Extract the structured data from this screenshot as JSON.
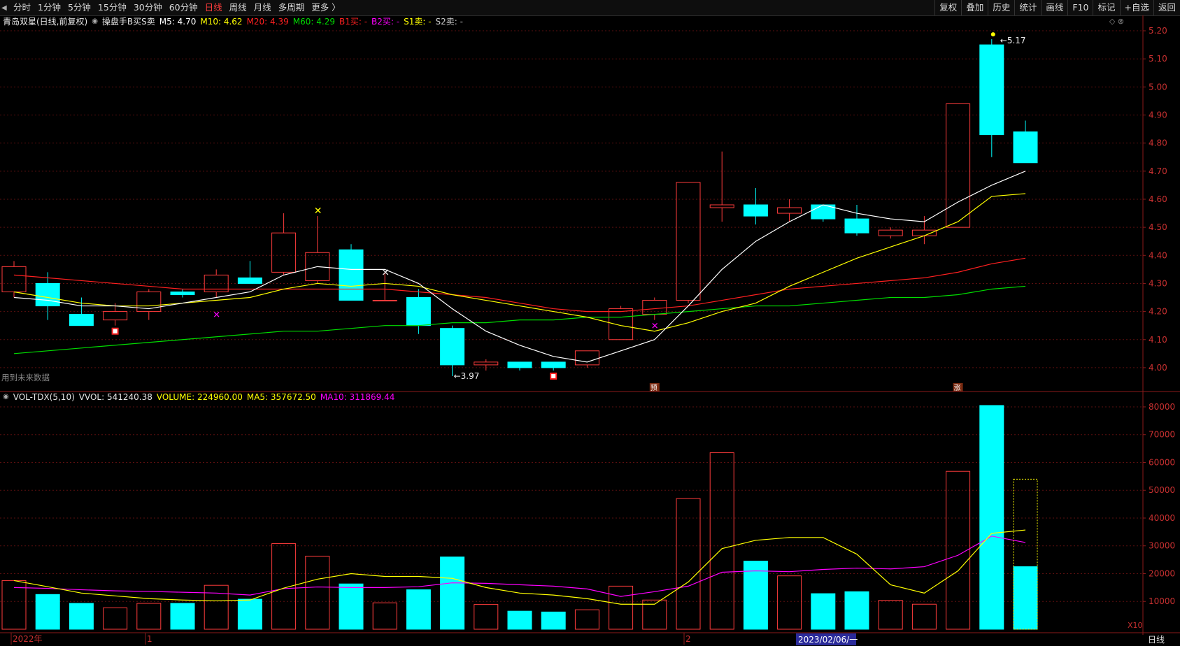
{
  "toolbar": {
    "left_items": [
      "分时",
      "1分钟",
      "5分钟",
      "15分钟",
      "30分钟",
      "60分钟",
      "日线",
      "周线",
      "月线",
      "多周期",
      "更多 〉"
    ],
    "active": "日线",
    "right_items": [
      "复权",
      "叠加",
      "历史",
      "统计",
      "画线",
      "F10",
      "标记",
      "+自选",
      "返回"
    ]
  },
  "price_legend": {
    "stock": "青岛双星(日线,前复权)",
    "indicator": "操盘手B买S卖",
    "m5": "M5: 4.70",
    "m10": "M10: 4.62",
    "m20": "M20: 4.39",
    "m60": "M60: 4.29",
    "b1": "B1买: -",
    "b2": "B2买: -",
    "s1": "S1卖: -",
    "s2": "S2卖: -"
  },
  "volume_legend": {
    "name": "VOL-TDX(5,10)",
    "vvol": "VVOL: 541240.38",
    "volume": "VOLUME: 224960.00",
    "ma5": "MA5: 357672.50",
    "ma10": "MA10: 311869.44"
  },
  "annotations": {
    "future_data": "用到未来数据",
    "high_label": "5.17",
    "low_label": "3.97",
    "marker_yu": "预",
    "marker_zhang": "涨",
    "vol_scale": "X10",
    "period_label": "日线"
  },
  "x_axis": {
    "labels": [
      "2022年",
      "1",
      "2"
    ],
    "cursor_date": "2023/02/06/一"
  },
  "colors": {
    "up": "#ff3c3c",
    "down": "#00ffff",
    "m5": "#ffffff",
    "m10": "#ffff00",
    "m20": "#ff2020",
    "m60": "#00dd00",
    "ma10_vol": "#ff00ff"
  },
  "chart_data": [
    {
      "type": "candlestick",
      "y_ticks": [
        4.0,
        4.1,
        4.2,
        4.3,
        4.4,
        4.5,
        4.6,
        4.7,
        4.8,
        4.9,
        5.0,
        5.1,
        5.2
      ],
      "ylim": [
        3.94,
        5.22
      ],
      "candles": [
        {
          "o": 4.27,
          "c": 4.36,
          "h": 4.38,
          "l": 4.25
        },
        {
          "o": 4.3,
          "c": 4.22,
          "h": 4.34,
          "l": 4.17
        },
        {
          "o": 4.19,
          "c": 4.15,
          "h": 4.25,
          "l": 4.15
        },
        {
          "o": 4.17,
          "c": 4.2,
          "h": 4.23,
          "l": 4.15
        },
        {
          "o": 4.2,
          "c": 4.27,
          "h": 4.28,
          "l": 4.17
        },
        {
          "o": 4.27,
          "c": 4.26,
          "h": 4.28,
          "l": 4.25
        },
        {
          "o": 4.27,
          "c": 4.33,
          "h": 4.35,
          "l": 4.25
        },
        {
          "o": 4.32,
          "c": 4.3,
          "h": 4.38,
          "l": 4.3
        },
        {
          "o": 4.34,
          "c": 4.48,
          "h": 4.55,
          "l": 4.33
        },
        {
          "o": 4.31,
          "c": 4.41,
          "h": 4.54,
          "l": 4.3
        },
        {
          "o": 4.42,
          "c": 4.24,
          "h": 4.44,
          "l": 4.24
        },
        {
          "o": 4.24,
          "c": 4.24,
          "h": 4.34,
          "l": 4.24
        },
        {
          "o": 4.25,
          "c": 4.15,
          "h": 4.28,
          "l": 4.12
        },
        {
          "o": 4.14,
          "c": 4.01,
          "h": 4.15,
          "l": 3.97
        },
        {
          "o": 4.01,
          "c": 4.02,
          "h": 4.03,
          "l": 3.99
        },
        {
          "o": 4.02,
          "c": 4.0,
          "h": 4.02,
          "l": 3.99
        },
        {
          "o": 4.02,
          "c": 4.0,
          "h": 4.02,
          "l": 3.99
        },
        {
          "o": 4.01,
          "c": 4.06,
          "h": 4.06,
          "l": 4.0
        },
        {
          "o": 4.1,
          "c": 4.21,
          "h": 4.22,
          "l": 4.1
        },
        {
          "o": 4.19,
          "c": 4.24,
          "h": 4.25,
          "l": 4.17
        },
        {
          "o": 4.24,
          "c": 4.66,
          "h": 4.66,
          "l": 4.23
        },
        {
          "o": 4.57,
          "c": 4.58,
          "h": 4.77,
          "l": 4.52
        },
        {
          "o": 4.58,
          "c": 4.54,
          "h": 4.64,
          "l": 4.51
        },
        {
          "o": 4.55,
          "c": 4.57,
          "h": 4.6,
          "l": 4.52
        },
        {
          "o": 4.58,
          "c": 4.53,
          "h": 4.58,
          "l": 4.52
        },
        {
          "o": 4.53,
          "c": 4.48,
          "h": 4.58,
          "l": 4.47
        },
        {
          "o": 4.47,
          "c": 4.49,
          "h": 4.5,
          "l": 4.46
        },
        {
          "o": 4.47,
          "c": 4.49,
          "h": 4.54,
          "l": 4.44
        },
        {
          "o": 4.5,
          "c": 4.94,
          "h": 4.94,
          "l": 4.5
        },
        {
          "o": 5.15,
          "c": 4.83,
          "h": 5.17,
          "l": 4.75
        },
        {
          "o": 4.84,
          "c": 4.73,
          "h": 4.88,
          "l": 4.73
        }
      ],
      "m5": [
        4.25,
        4.24,
        4.22,
        4.22,
        4.21,
        4.23,
        4.25,
        4.27,
        4.33,
        4.36,
        4.35,
        4.35,
        4.3,
        4.21,
        4.13,
        4.08,
        4.04,
        4.02,
        4.06,
        4.1,
        4.22,
        4.35,
        4.45,
        4.52,
        4.58,
        4.55,
        4.53,
        4.52,
        4.59,
        4.65,
        4.7
      ],
      "m10": [
        4.27,
        4.25,
        4.23,
        4.22,
        4.22,
        4.23,
        4.24,
        4.25,
        4.28,
        4.3,
        4.29,
        4.3,
        4.29,
        4.26,
        4.24,
        4.22,
        4.2,
        4.18,
        4.15,
        4.13,
        4.16,
        4.2,
        4.23,
        4.29,
        4.34,
        4.39,
        4.43,
        4.47,
        4.52,
        4.61,
        4.62
      ],
      "m20": [
        4.33,
        4.32,
        4.31,
        4.3,
        4.29,
        4.28,
        4.28,
        4.28,
        4.28,
        4.28,
        4.28,
        4.28,
        4.27,
        4.26,
        4.25,
        4.23,
        4.21,
        4.2,
        4.2,
        4.21,
        4.22,
        4.24,
        4.26,
        4.28,
        4.29,
        4.3,
        4.31,
        4.32,
        4.34,
        4.37,
        4.39
      ],
      "m60": [
        4.05,
        4.06,
        4.07,
        4.08,
        4.09,
        4.1,
        4.11,
        4.12,
        4.13,
        4.13,
        4.14,
        4.15,
        4.15,
        4.16,
        4.16,
        4.17,
        4.17,
        4.18,
        4.18,
        4.19,
        4.2,
        4.21,
        4.22,
        4.22,
        4.23,
        4.24,
        4.25,
        4.25,
        4.26,
        4.28,
        4.29
      ]
    },
    {
      "type": "bar",
      "y_ticks": [
        10000,
        20000,
        30000,
        40000,
        50000,
        60000,
        70000,
        80000
      ],
      "ylim": [
        0,
        81000
      ],
      "values": [
        17500,
        12500,
        9300,
        7700,
        9300,
        9300,
        15800,
        10800,
        30800,
        26300,
        16300,
        9500,
        14200,
        26000,
        8900,
        6500,
        6200,
        7000,
        15500,
        10500,
        47000,
        63500,
        24500,
        19200,
        12800,
        13500,
        10400,
        9000,
        56800,
        80500,
        22500
      ],
      "preview_value": 54000,
      "ma5": [
        17500,
        15300,
        13000,
        12000,
        11000,
        10500,
        10200,
        10500,
        14800,
        18000,
        20000,
        19000,
        19000,
        18300,
        15000,
        13000,
        12300,
        11000,
        9000,
        9000,
        17000,
        29000,
        32000,
        33000,
        33000,
        27000,
        16000,
        13000,
        21000,
        34500,
        35700
      ],
      "ma10": [
        15000,
        14700,
        14200,
        13800,
        13600,
        13300,
        13000,
        12300,
        14600,
        15200,
        15000,
        15000,
        15300,
        16700,
        16500,
        16000,
        15500,
        14500,
        11800,
        13500,
        15500,
        20500,
        21000,
        20700,
        21500,
        22000,
        21700,
        22500,
        26600,
        33500,
        31200
      ]
    }
  ]
}
